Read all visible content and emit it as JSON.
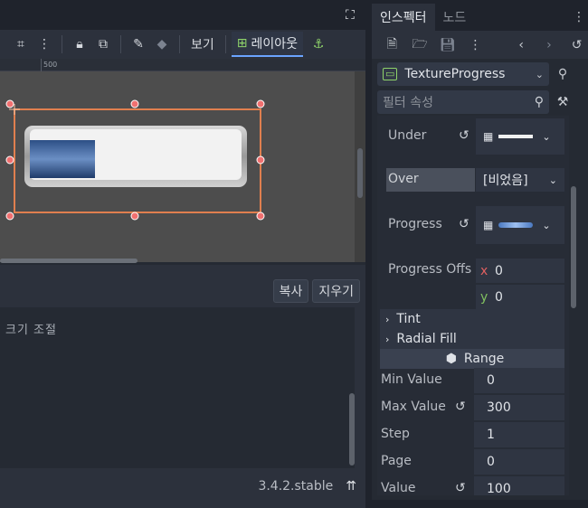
{
  "toolbar": {
    "view_label": "보기",
    "layout_label": "레이아웃"
  },
  "ruler": {
    "mark": "500"
  },
  "bottom_panel": {
    "copy_label": "복사",
    "clear_label": "지우기",
    "log_text": "크기 조절",
    "version": "3.4.2.stable"
  },
  "inspector": {
    "tab_inspector": "인스펙터",
    "tab_node": "노드",
    "node_type": "TextureProgress",
    "filter_placeholder": "필터 속성",
    "props": {
      "under_label": "Under",
      "over_label": "Over",
      "over_value": "[비었음]",
      "progress_label": "Progress",
      "progress_offset_label": "Progress Offs",
      "offset_x_axis": "x",
      "offset_x": "0",
      "offset_y_axis": "y",
      "offset_y": "0",
      "tint_label": "Tint",
      "radial_fill_label": "Radial Fill",
      "range_label": "Range",
      "min_value_label": "Min Value",
      "min_value": "0",
      "max_value_label": "Max Value",
      "max_value": "300",
      "step_label": "Step",
      "step": "1",
      "page_label": "Page",
      "page": "0",
      "value_label": "Value",
      "value": "100"
    }
  },
  "progress_fill": 0.333,
  "colors": {
    "accent": "#6aa4ff",
    "selection": "#e07f4f",
    "handle": "#f07070",
    "x_axis": "#e06060",
    "y_axis": "#80c060"
  }
}
